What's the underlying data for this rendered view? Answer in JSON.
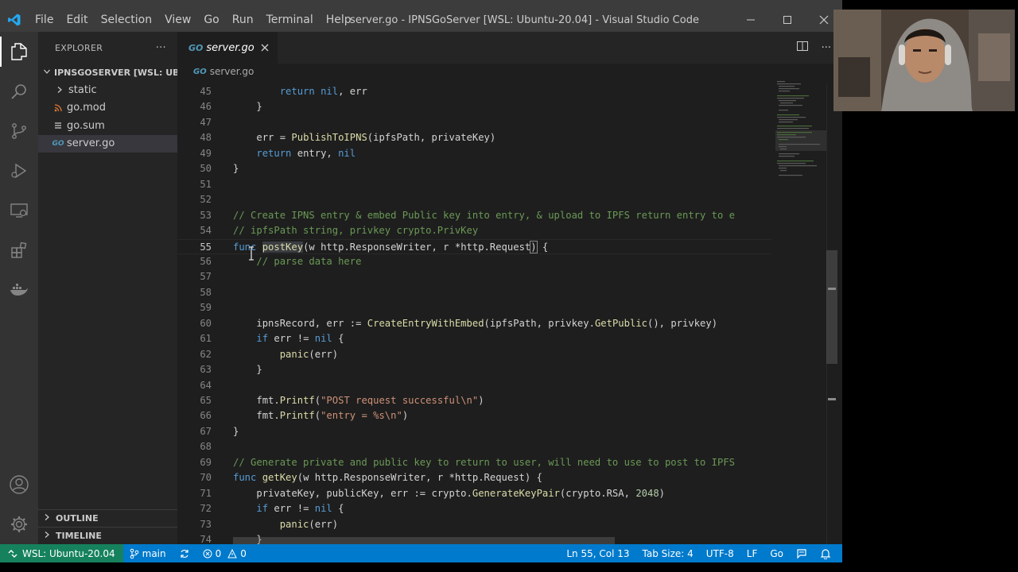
{
  "window": {
    "title": "server.go - IPNSGoServer [WSL: Ubuntu-20.04] - Visual Studio Code",
    "menu": [
      "File",
      "Edit",
      "Selection",
      "View",
      "Go",
      "Run",
      "Terminal",
      "Help"
    ]
  },
  "activity_bar": {
    "items": [
      "explorer-icon",
      "search-icon",
      "source-control-icon",
      "run-debug-icon",
      "remote-explorer-icon",
      "extensions-icon",
      "docker-icon"
    ],
    "bottom": [
      "account-icon",
      "settings-gear-icon"
    ]
  },
  "sidebar": {
    "title": "EXPLORER",
    "more": "···",
    "workspace": "IPNSGOSERVER [WSL: UBU...",
    "tree": [
      {
        "label": "static",
        "type": "folder"
      },
      {
        "label": "go.mod",
        "type": "mod"
      },
      {
        "label": "go.sum",
        "type": "sum"
      },
      {
        "label": "server.go",
        "type": "go",
        "selected": true
      }
    ],
    "outline": "OUTLINE",
    "timeline": "TIMELINE"
  },
  "editor": {
    "tab": "server.go",
    "breadcrumb": "server.go",
    "current_line": 55,
    "lines": [
      {
        "n": 45,
        "indent": 2,
        "tokens": [
          [
            "kw",
            "return"
          ],
          [
            "",
            " "
          ],
          [
            "kw",
            "nil"
          ],
          [
            "",
            ", err"
          ]
        ]
      },
      {
        "n": 46,
        "indent": 1,
        "tokens": [
          [
            "",
            "}"
          ]
        ]
      },
      {
        "n": 47,
        "indent": 0,
        "tokens": []
      },
      {
        "n": 48,
        "indent": 1,
        "tokens": [
          [
            "",
            "err = "
          ],
          [
            "fn",
            "PublishToIPNS"
          ],
          [
            "",
            "(ipfsPath, privateKey)"
          ]
        ]
      },
      {
        "n": 49,
        "indent": 1,
        "tokens": [
          [
            "kw",
            "return"
          ],
          [
            "",
            " entry, "
          ],
          [
            "kw",
            "nil"
          ]
        ]
      },
      {
        "n": 50,
        "indent": 0,
        "tokens": [
          [
            "",
            "}"
          ]
        ]
      },
      {
        "n": 51,
        "indent": 0,
        "tokens": []
      },
      {
        "n": 52,
        "indent": 0,
        "tokens": []
      },
      {
        "n": 53,
        "indent": 0,
        "tokens": [
          [
            "cm",
            "// Create IPNS entry & embed Public key into entry, & upload to IPFS return entry to e"
          ]
        ]
      },
      {
        "n": 54,
        "indent": 0,
        "tokens": [
          [
            "cm",
            "// ipfsPath string, privkey crypto.PrivKey"
          ]
        ]
      },
      {
        "n": 55,
        "indent": 0,
        "tokens": [
          [
            "kw",
            "func"
          ],
          [
            "",
            " "
          ],
          [
            "fnhl",
            "postKey"
          ],
          [
            "",
            "(w http.ResponseWriter, r *http.Request"
          ],
          [
            "bracket",
            ")"
          ],
          [
            "",
            " {"
          ]
        ]
      },
      {
        "n": 56,
        "indent": 1,
        "tokens": [
          [
            "cm",
            "// parse data here"
          ]
        ]
      },
      {
        "n": 57,
        "indent": 0,
        "tokens": []
      },
      {
        "n": 58,
        "indent": 0,
        "tokens": []
      },
      {
        "n": 59,
        "indent": 0,
        "tokens": []
      },
      {
        "n": 60,
        "indent": 1,
        "tokens": [
          [
            "",
            "ipnsRecord, err := "
          ],
          [
            "fn",
            "CreateEntryWithEmbed"
          ],
          [
            "",
            "(ipfsPath, privkey."
          ],
          [
            "fn",
            "GetPublic"
          ],
          [
            "",
            "(), privkey)"
          ]
        ]
      },
      {
        "n": 61,
        "indent": 1,
        "tokens": [
          [
            "kw",
            "if"
          ],
          [
            "",
            " err != "
          ],
          [
            "kw",
            "nil"
          ],
          [
            "",
            " {"
          ]
        ]
      },
      {
        "n": 62,
        "indent": 2,
        "tokens": [
          [
            "fn",
            "panic"
          ],
          [
            "",
            "(err)"
          ]
        ]
      },
      {
        "n": 63,
        "indent": 1,
        "tokens": [
          [
            "",
            "}"
          ]
        ]
      },
      {
        "n": 64,
        "indent": 0,
        "tokens": []
      },
      {
        "n": 65,
        "indent": 1,
        "tokens": [
          [
            "",
            "fmt."
          ],
          [
            "fn",
            "Printf"
          ],
          [
            "",
            "("
          ],
          [
            "str",
            "\"POST request successful\\n\""
          ],
          [
            "",
            ")"
          ]
        ]
      },
      {
        "n": 66,
        "indent": 1,
        "tokens": [
          [
            "",
            "fmt."
          ],
          [
            "fn",
            "Printf"
          ],
          [
            "",
            "("
          ],
          [
            "str",
            "\"entry = %s\\n\""
          ],
          [
            "",
            ")"
          ]
        ]
      },
      {
        "n": 67,
        "indent": 0,
        "tokens": [
          [
            "",
            "}"
          ]
        ]
      },
      {
        "n": 68,
        "indent": 0,
        "tokens": []
      },
      {
        "n": 69,
        "indent": 0,
        "tokens": [
          [
            "cm",
            "// Generate private and public key to return to user, will need to use to post to IPFS"
          ]
        ]
      },
      {
        "n": 70,
        "indent": 0,
        "tokens": [
          [
            "kw",
            "func"
          ],
          [
            "",
            " "
          ],
          [
            "fn",
            "getKey"
          ],
          [
            "",
            "(w http.ResponseWriter, r *http.Request) {"
          ]
        ]
      },
      {
        "n": 71,
        "indent": 1,
        "tokens": [
          [
            "",
            "privateKey, publicKey, err := crypto."
          ],
          [
            "fn",
            "GenerateKeyPair"
          ],
          [
            "",
            "(crypto.RSA, "
          ],
          [
            "num",
            "2048"
          ],
          [
            "",
            ")"
          ]
        ]
      },
      {
        "n": 72,
        "indent": 1,
        "tokens": [
          [
            "kw",
            "if"
          ],
          [
            "",
            " err != "
          ],
          [
            "kw",
            "nil"
          ],
          [
            "",
            " {"
          ]
        ]
      },
      {
        "n": 73,
        "indent": 2,
        "tokens": [
          [
            "fn",
            "panic"
          ],
          [
            "",
            "(err)"
          ]
        ]
      },
      {
        "n": 74,
        "indent": 1,
        "tokens": [
          [
            "",
            "}"
          ]
        ]
      }
    ]
  },
  "status_bar": {
    "remote": "WSL: Ubuntu-20.04",
    "branch": "main",
    "errors": "0",
    "warnings": "0",
    "position": "Ln 55, Col 13",
    "tab_size": "Tab Size: 4",
    "encoding": "UTF-8",
    "eol": "LF",
    "language": "Go"
  },
  "colors": {
    "accent": "#007acc",
    "remote": "#16825d",
    "titlebar": "#3c3c3c",
    "sidebar": "#252526",
    "editor": "#1e1e1e"
  }
}
